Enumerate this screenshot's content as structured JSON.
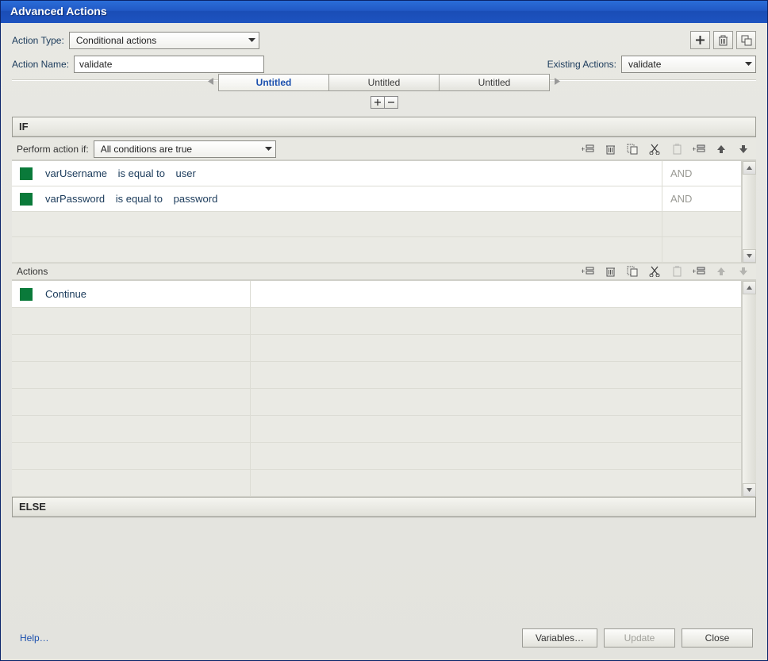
{
  "window": {
    "title": "Advanced Actions"
  },
  "labels": {
    "action_type": "Action Type:",
    "action_name": "Action Name:",
    "existing_actions": "Existing Actions:",
    "perform_if": "Perform action if:",
    "if": "IF",
    "else": "ELSE",
    "actions": "Actions"
  },
  "fields": {
    "action_type_value": "Conditional actions",
    "action_name_value": "validate",
    "existing_actions_value": "validate",
    "perform_if_value": "All conditions are true"
  },
  "tabs": [
    {
      "label": "Untitled",
      "active": true
    },
    {
      "label": "Untitled",
      "active": false
    },
    {
      "label": "Untitled",
      "active": false
    }
  ],
  "conditions": [
    {
      "var": "varUsername",
      "op": "is equal to",
      "val": "user",
      "join": "AND"
    },
    {
      "var": "varPassword",
      "op": "is equal to",
      "val": "password",
      "join": "AND"
    }
  ],
  "actions_list": [
    {
      "label": "Continue"
    }
  ],
  "buttons": {
    "help": "Help…",
    "variables": "Variables…",
    "update": "Update",
    "close": "Close"
  },
  "icons": {
    "plus": "plus-icon",
    "trash": "trash-icon",
    "duplicate": "duplicate-icon",
    "add_row": "add-row-icon",
    "copy": "copy-icon",
    "cut": "cut-icon",
    "paste": "paste-icon",
    "insert": "insert-row-icon",
    "up": "arrow-up-icon",
    "down": "arrow-down-icon"
  }
}
